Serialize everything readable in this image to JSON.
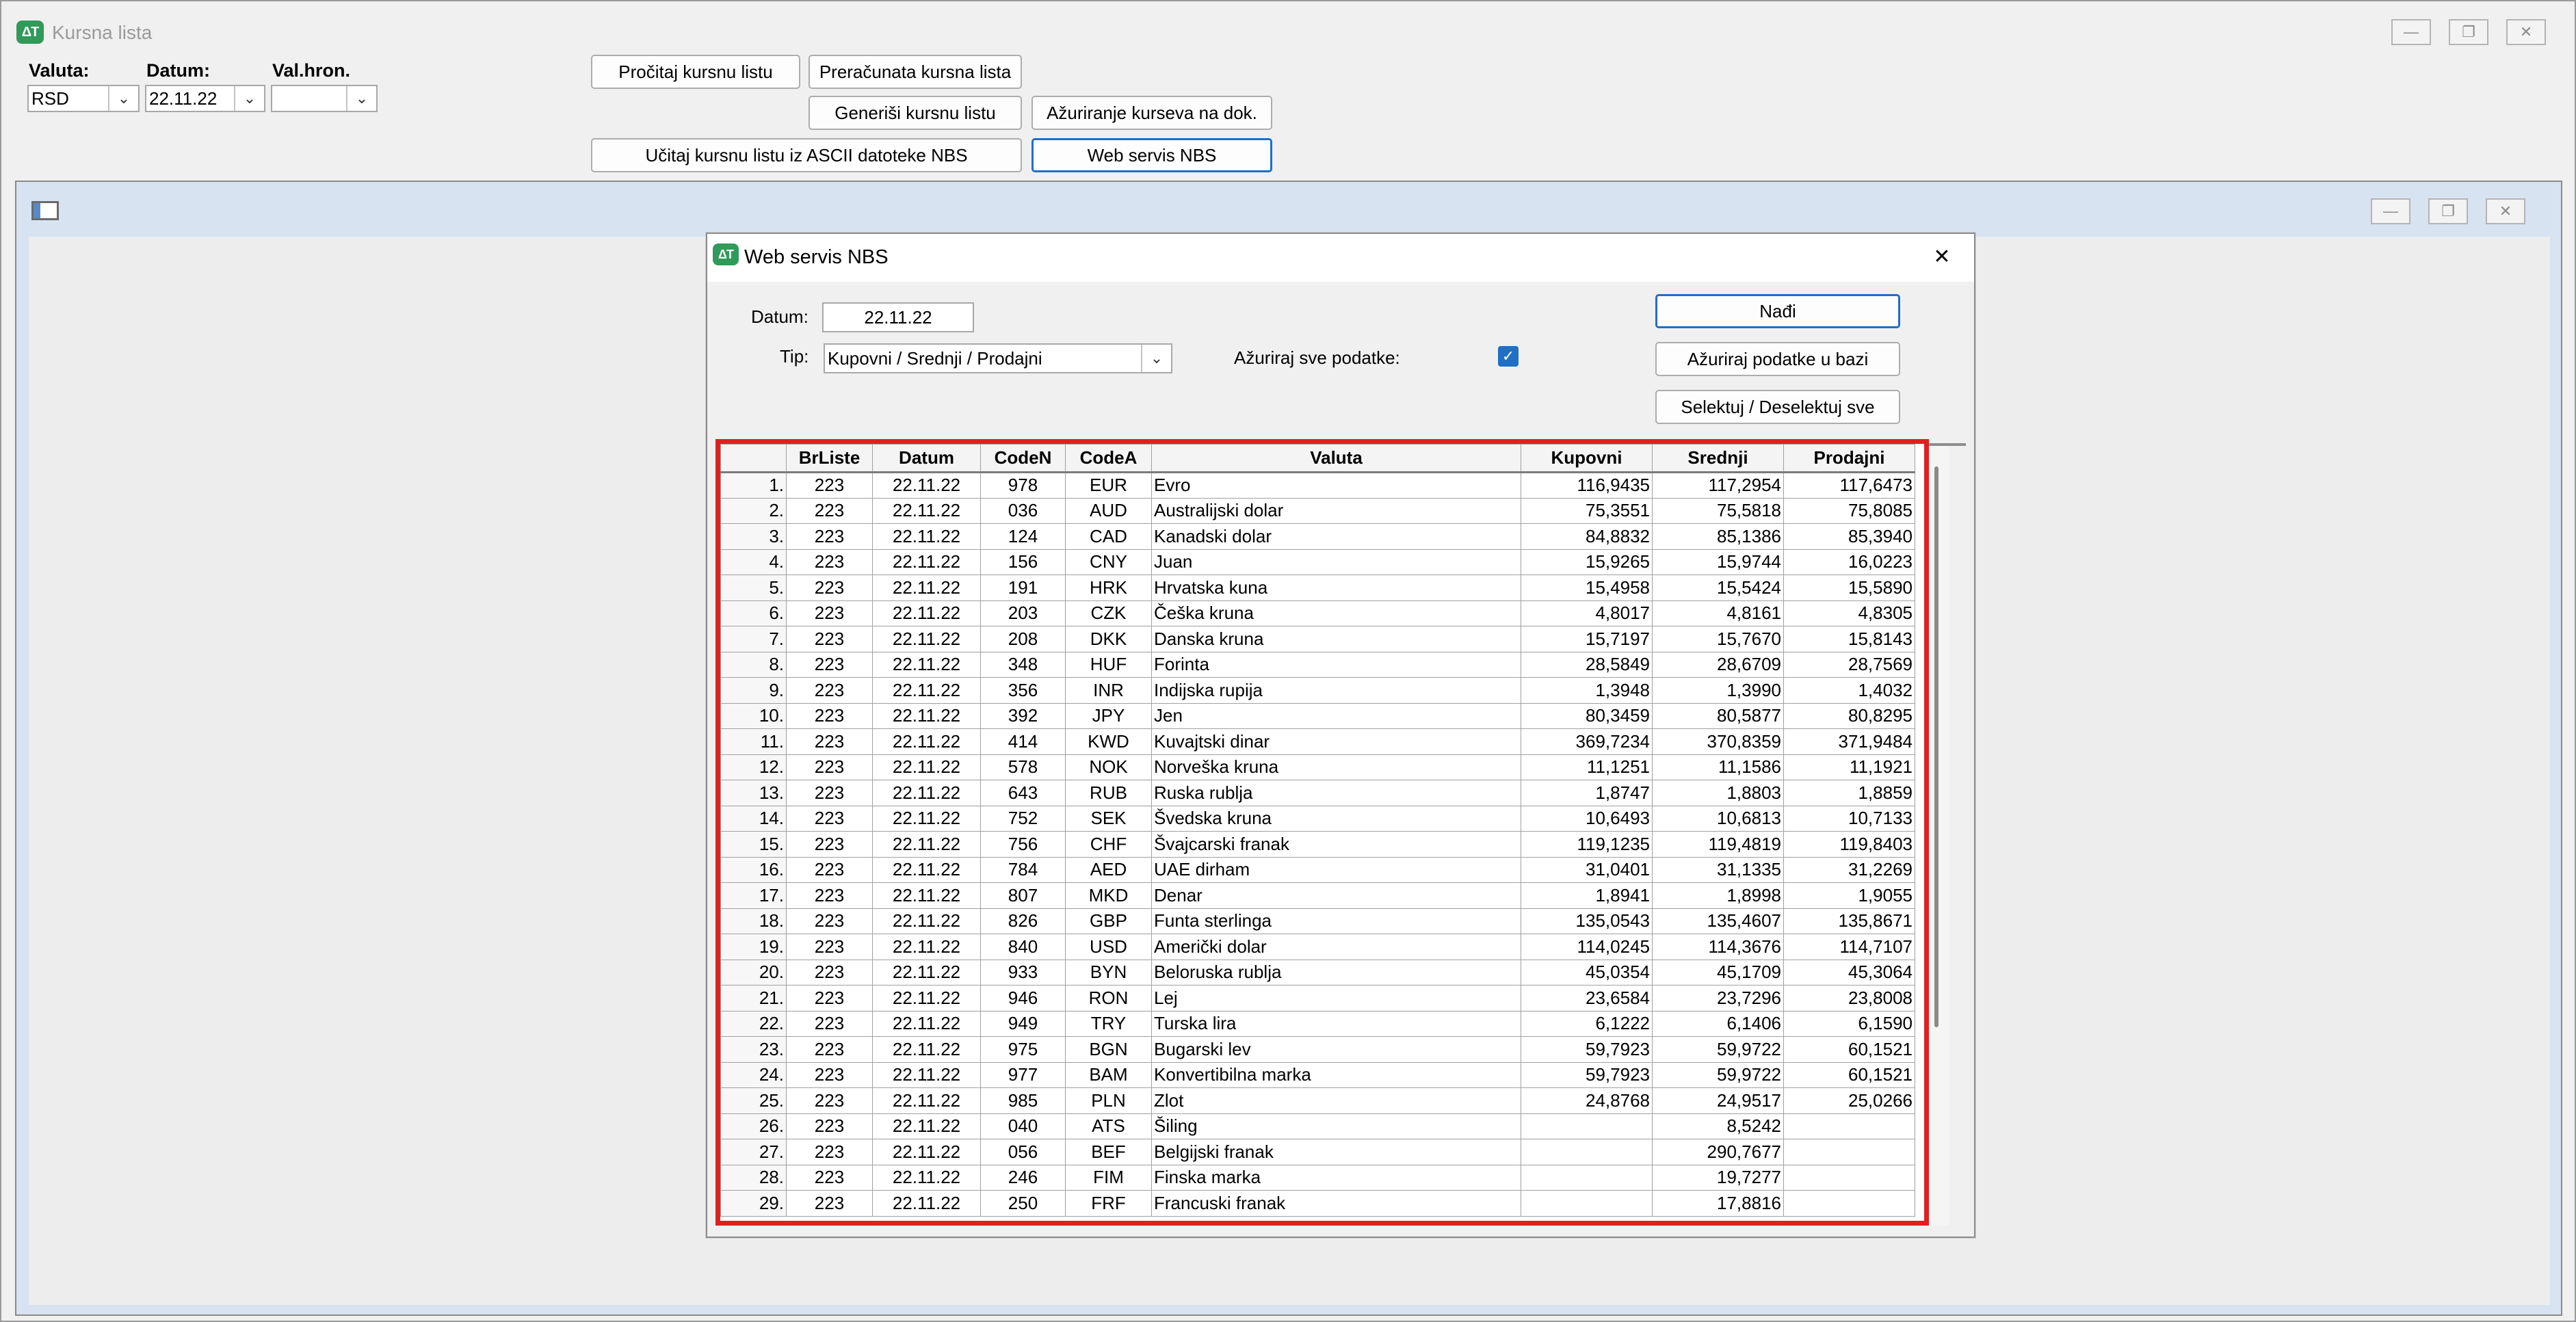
{
  "main_window": {
    "title": "Kursna lista",
    "controls": {
      "minimize": "—",
      "restore": "❐",
      "close": "✕"
    },
    "labels": {
      "valuta": "Valuta:",
      "datum": "Datum:",
      "valhron": "Val.hron."
    },
    "valuta_value": "RSD",
    "datum_value": "22.11.22",
    "valhron_value": "",
    "buttons": {
      "procitaj": "Pročitaj kursnu listu",
      "preracunata": "Preračunata kursna lista",
      "generisi": "Generiši kursnu listu",
      "azuriranje": "Ažuriranje kurseva na dok.",
      "ucitaj": "Učitaj kursnu listu iz ASCII datoteke NBS",
      "webservis": "Web servis NBS"
    }
  },
  "dialog": {
    "title": "Web servis NBS",
    "close": "✕",
    "datum_label": "Datum:",
    "datum_value": "22.11.22",
    "tip_label": "Tip:",
    "tip_value": "Kupovni / Srednji / Prodajni",
    "azuriraj_label": "Ažuriraj sve podatke:",
    "azuriraj_checked": true,
    "buttons": {
      "nadji": "Nađi",
      "azuriraj": "Ažuriraj podatke u bazi",
      "selektuj": "Selektuj / Deselektuj sve"
    }
  },
  "grid": {
    "columns": [
      "",
      "BrListe",
      "Datum",
      "CodeN",
      "CodeA",
      "Valuta",
      "Kupovni",
      "Srednji",
      "Prodajni"
    ],
    "rows": [
      [
        "1.",
        "223",
        "22.11.22",
        "978",
        "EUR",
        "Evro",
        "116,9435",
        "117,2954",
        "117,6473"
      ],
      [
        "2.",
        "223",
        "22.11.22",
        "036",
        "AUD",
        "Australijski dolar",
        "75,3551",
        "75,5818",
        "75,8085"
      ],
      [
        "3.",
        "223",
        "22.11.22",
        "124",
        "CAD",
        "Kanadski dolar",
        "84,8832",
        "85,1386",
        "85,3940"
      ],
      [
        "4.",
        "223",
        "22.11.22",
        "156",
        "CNY",
        "Juan",
        "15,9265",
        "15,9744",
        "16,0223"
      ],
      [
        "5.",
        "223",
        "22.11.22",
        "191",
        "HRK",
        "Hrvatska kuna",
        "15,4958",
        "15,5424",
        "15,5890"
      ],
      [
        "6.",
        "223",
        "22.11.22",
        "203",
        "CZK",
        "Češka kruna",
        "4,8017",
        "4,8161",
        "4,8305"
      ],
      [
        "7.",
        "223",
        "22.11.22",
        "208",
        "DKK",
        "Danska kruna",
        "15,7197",
        "15,7670",
        "15,8143"
      ],
      [
        "8.",
        "223",
        "22.11.22",
        "348",
        "HUF",
        "Forinta",
        "28,5849",
        "28,6709",
        "28,7569"
      ],
      [
        "9.",
        "223",
        "22.11.22",
        "356",
        "INR",
        "Indijska rupija",
        "1,3948",
        "1,3990",
        "1,4032"
      ],
      [
        "10.",
        "223",
        "22.11.22",
        "392",
        "JPY",
        "Jen",
        "80,3459",
        "80,5877",
        "80,8295"
      ],
      [
        "11.",
        "223",
        "22.11.22",
        "414",
        "KWD",
        "Kuvajtski dinar",
        "369,7234",
        "370,8359",
        "371,9484"
      ],
      [
        "12.",
        "223",
        "22.11.22",
        "578",
        "NOK",
        "Norveška kruna",
        "11,1251",
        "11,1586",
        "11,1921"
      ],
      [
        "13.",
        "223",
        "22.11.22",
        "643",
        "RUB",
        "Ruska rublja",
        "1,8747",
        "1,8803",
        "1,8859"
      ],
      [
        "14.",
        "223",
        "22.11.22",
        "752",
        "SEK",
        "Švedska kruna",
        "10,6493",
        "10,6813",
        "10,7133"
      ],
      [
        "15.",
        "223",
        "22.11.22",
        "756",
        "CHF",
        "Švajcarski franak",
        "119,1235",
        "119,4819",
        "119,8403"
      ],
      [
        "16.",
        "223",
        "22.11.22",
        "784",
        "AED",
        "UAE dirham",
        "31,0401",
        "31,1335",
        "31,2269"
      ],
      [
        "17.",
        "223",
        "22.11.22",
        "807",
        "MKD",
        "Denar",
        "1,8941",
        "1,8998",
        "1,9055"
      ],
      [
        "18.",
        "223",
        "22.11.22",
        "826",
        "GBP",
        "Funta sterlinga",
        "135,0543",
        "135,4607",
        "135,8671"
      ],
      [
        "19.",
        "223",
        "22.11.22",
        "840",
        "USD",
        "Američki dolar",
        "114,0245",
        "114,3676",
        "114,7107"
      ],
      [
        "20.",
        "223",
        "22.11.22",
        "933",
        "BYN",
        "Beloruska rublja",
        "45,0354",
        "45,1709",
        "45,3064"
      ],
      [
        "21.",
        "223",
        "22.11.22",
        "946",
        "RON",
        "Lej",
        "23,6584",
        "23,7296",
        "23,8008"
      ],
      [
        "22.",
        "223",
        "22.11.22",
        "949",
        "TRY",
        "Turska lira",
        "6,1222",
        "6,1406",
        "6,1590"
      ],
      [
        "23.",
        "223",
        "22.11.22",
        "975",
        "BGN",
        "Bugarski lev",
        "59,7923",
        "59,9722",
        "60,1521"
      ],
      [
        "24.",
        "223",
        "22.11.22",
        "977",
        "BAM",
        "Konvertibilna marka",
        "59,7923",
        "59,9722",
        "60,1521"
      ],
      [
        "25.",
        "223",
        "22.11.22",
        "985",
        "PLN",
        "Zlot",
        "24,8768",
        "24,9517",
        "25,0266"
      ],
      [
        "26.",
        "223",
        "22.11.22",
        "040",
        "ATS",
        "Šiling",
        "",
        "8,5242",
        ""
      ],
      [
        "27.",
        "223",
        "22.11.22",
        "056",
        "BEF",
        "Belgijski franak",
        "",
        "290,7677",
        ""
      ],
      [
        "28.",
        "223",
        "22.11.22",
        "246",
        "FIM",
        "Finska marka",
        "",
        "19,7277",
        ""
      ],
      [
        "29.",
        "223",
        "22.11.22",
        "250",
        "FRF",
        "Francuski franak",
        "",
        "17,8816",
        ""
      ]
    ]
  }
}
